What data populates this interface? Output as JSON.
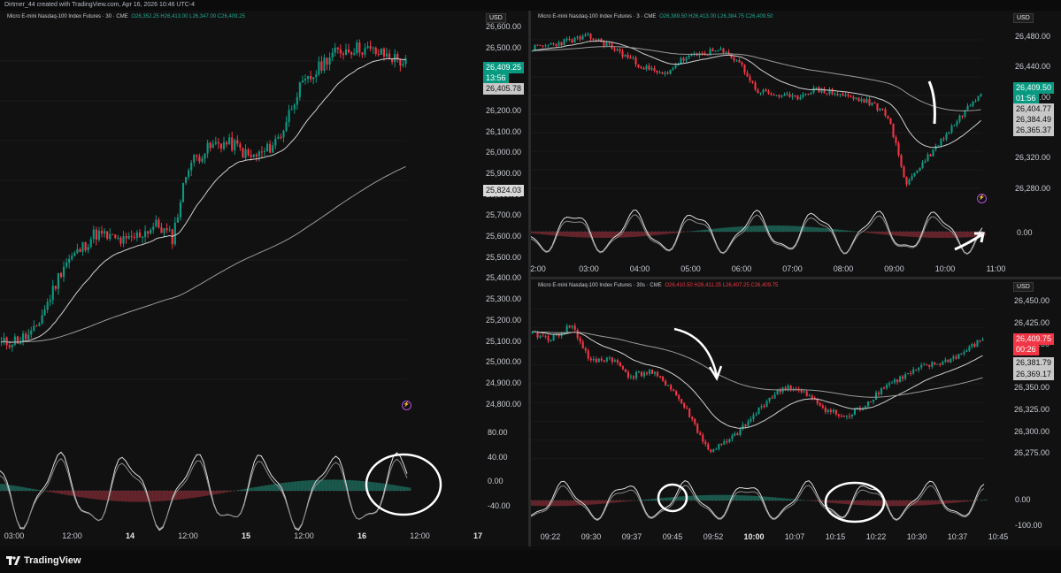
{
  "header": {
    "credit": "Dirtmer_44 created with TradingView.com, Apr 16, 2026 10:46 UTC-4"
  },
  "footer": {
    "brand": "TradingView",
    "logo_icon": "tradingview-logo-icon"
  },
  "colors": {
    "up": "#089981",
    "down": "#f23645",
    "bg": "#111111"
  },
  "left_chart": {
    "title": "Micro E-mini Nasdaq-100 Index Futures · 30 · CME",
    "ohlc": "O26,352.25 H26,413.00 L26,347.00 C26,409.25",
    "currency": "USD",
    "price_axis": [
      "26,600.00",
      "26,500.00",
      "26,400.00",
      "26,300.00",
      "26,200.00",
      "26,100.00",
      "26,000.00",
      "25,900.00",
      "25,800.00",
      "25,700.00",
      "25,600.00",
      "25,500.00",
      "25,400.00",
      "25,300.00",
      "25,200.00",
      "25,100.00",
      "25,000.00",
      "24,900.00",
      "24,800.00"
    ],
    "last_price": "26,409.25",
    "countdown": "13:56",
    "ma_fast": "26,405.78",
    "ma_slow": "25,824.03",
    "osc_axis": [
      "80.00",
      "40.00",
      "0.00",
      "-40.00"
    ],
    "time_axis": [
      "03:00",
      "12:00",
      "14",
      "12:00",
      "15",
      "12:00",
      "16",
      "12:00",
      "17"
    ]
  },
  "top_right_chart": {
    "title": "Micro E-mini Nasdaq-100 Index Futures · 3 · CME",
    "ohlc": "O26,389.50 H26,413.00 L26,384.75 C26,409.50",
    "currency": "USD",
    "price_axis": [
      "26,480.00",
      "26,440.00",
      "26,400.00",
      "26,360.00",
      "26,320.00",
      "26,280.00"
    ],
    "last_price": "26,409.50",
    "countdown": "01:56",
    "ma1": "26,404.77",
    "ma2": "26,384.49",
    "ma3": "26,365.37",
    "osc_axis": [
      "0.00"
    ],
    "time_axis": [
      "2:00",
      "03:00",
      "04:00",
      "05:00",
      "06:00",
      "07:00",
      "08:00",
      "09:00",
      "10:00",
      "11:00"
    ]
  },
  "bottom_right_chart": {
    "title": "Micro E-mini Nasdaq-100 Index Futures · 30s · CME",
    "ohlc": "O26,410.50 H26,411.25 L26,407.25 C26,409.75",
    "currency": "USD",
    "price_axis": [
      "26,450.00",
      "26,425.00",
      "26,400.00",
      "26,375.00",
      "26,350.00",
      "26,325.00",
      "26,300.00",
      "26,275.00"
    ],
    "last_price": "26,409.75",
    "countdown": "00:26",
    "ma1": "26,381.79",
    "ma2": "26,369.17",
    "osc_axis": [
      "0.00",
      "-100.00"
    ],
    "time_axis": [
      "09:22",
      "09:30",
      "09:37",
      "09:45",
      "09:52",
      "10:00",
      "10:07",
      "10:15",
      "10:22",
      "10:30",
      "10:37",
      "10:45"
    ]
  },
  "chart_data": [
    {
      "type": "line",
      "title": "Micro E-mini Nasdaq-100 Index Futures · 30 · CME",
      "series": [
        {
          "name": "close",
          "values": [
            25140,
            25160,
            25180,
            25330,
            25500,
            25560,
            25640,
            25620,
            25600,
            25640,
            25680,
            25620,
            25950,
            26010,
            26050,
            26040,
            25980,
            26010,
            26090,
            26280,
            26350,
            26440,
            26470,
            26480,
            26460,
            26440,
            26409
          ]
        }
      ],
      "ylim": [
        24800,
        26600
      ]
    },
    {
      "type": "line",
      "title": "Micro E-mini Nasdaq-100 Index Futures · 3 · CME",
      "series": [
        {
          "name": "close",
          "values": [
            26465,
            26470,
            26475,
            26480,
            26470,
            26455,
            26440,
            26430,
            26450,
            26458,
            26462,
            26450,
            26410,
            26405,
            26400,
            26412,
            26408,
            26402,
            26395,
            26380,
            26290,
            26320,
            26350,
            26380,
            26409.5
          ]
        }
      ],
      "ylim": [
        26260,
        26500
      ]
    },
    {
      "type": "line",
      "title": "Micro E-mini Nasdaq-100 Index Futures · 30s · CME",
      "series": [
        {
          "name": "close",
          "values": [
            26415,
            26410,
            26425,
            26385,
            26390,
            26370,
            26375,
            26360,
            26330,
            26290,
            26300,
            26320,
            26345,
            26360,
            26350,
            26335,
            26325,
            26340,
            26360,
            26370,
            26380,
            26385,
            26395,
            26409.75
          ]
        }
      ],
      "ylim": [
        26262,
        26462
      ]
    }
  ]
}
